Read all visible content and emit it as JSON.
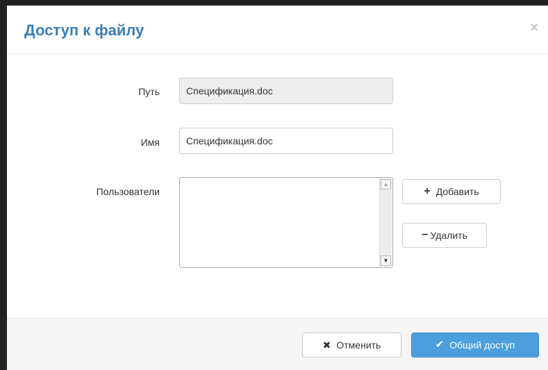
{
  "dialog": {
    "title": "Доступ к файлу",
    "close_symbol": "×"
  },
  "form": {
    "path_label": "Путь",
    "path_value": "Спецификация.doc",
    "name_label": "Имя",
    "name_value": "Спецификация.doc",
    "users_label": "Пользователи",
    "users": []
  },
  "buttons": {
    "add_icon": "+",
    "add_label": "Добавить",
    "remove_icon": "−",
    "remove_label": "Удалить",
    "cancel_icon": "✖",
    "cancel_label": "Отменить",
    "share_icon": "✔",
    "share_label": "Общий доступ"
  },
  "icons": {
    "add": "plus-icon",
    "remove": "minus-icon",
    "cancel": "x-icon",
    "share": "check-icon",
    "close": "close-icon"
  },
  "colors": {
    "title": "#3a7fb5",
    "primary_button": "#4a9fdc",
    "overlay": "#222222"
  }
}
